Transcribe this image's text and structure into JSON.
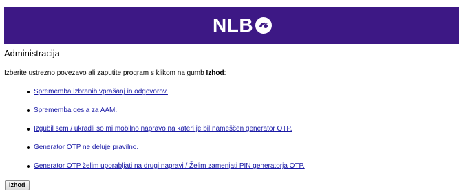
{
  "header": {
    "logo_text": "NLB",
    "brand_color": "#3d1885"
  },
  "main": {
    "title": "Administracija",
    "intro_text": "Izberite ustrezno povezavo ali zaputite program s klikom na gumb ",
    "intro_bold": "Izhod",
    "intro_end": ":",
    "links": [
      {
        "label": "Sprememba izbranih vprašanj in odgovorov."
      },
      {
        "label": "Sprememba gesla za AAM."
      },
      {
        "label": "Izgubil sem / ukradli so mi mobilno napravo na kateri je bil nameščen generator OTP."
      },
      {
        "label": "Generator OTP ne deluje pravilno."
      },
      {
        "label": "Generator OTP želim uporabljati na drugi napravi / Želim zamenjati PIN generatorja OTP."
      }
    ],
    "exit_button": "Izhod"
  }
}
